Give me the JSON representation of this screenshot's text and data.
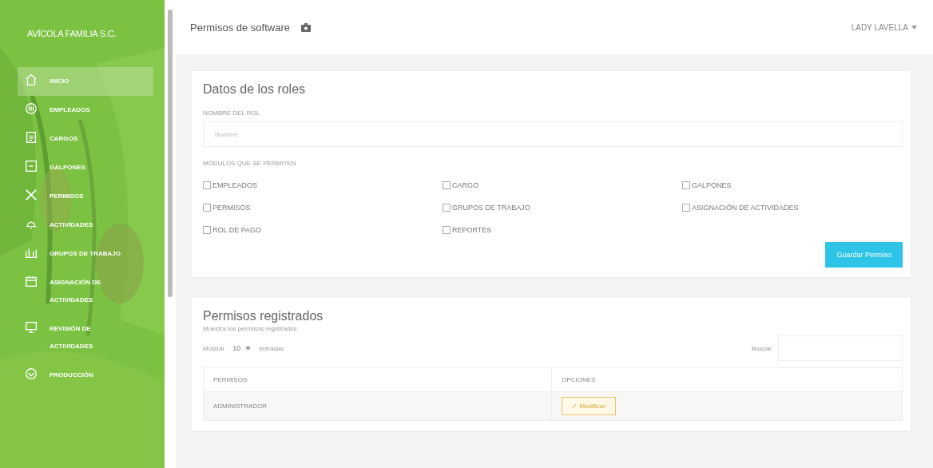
{
  "sidebar": {
    "brand": "AVÍCOLA FAMILIA S.C.",
    "items": [
      {
        "label": "INICIO",
        "selected": true
      },
      {
        "label": "EMPLEADOS",
        "selected": false
      },
      {
        "label": "CARGOS",
        "selected": false
      },
      {
        "label": "GALPONES",
        "selected": false
      },
      {
        "label": "PERMISOS",
        "selected": false
      },
      {
        "label": "ACTIVIDADES",
        "selected": false
      },
      {
        "label": "GRUPOS DE TRABAJO",
        "selected": false
      },
      {
        "label": "ASIGNACIÓN DE ACTIVIDADES",
        "selected": false
      },
      {
        "label": "REVISIÓN DE ACTIVIDADES",
        "selected": false
      },
      {
        "label": "PRODUCCIÓN",
        "selected": false
      }
    ]
  },
  "header": {
    "title": "Permisos de software",
    "user": "LADY LAVELLA"
  },
  "roles_card": {
    "title": "Datos de los roles",
    "name_label": "NOMBRE DEL ROL",
    "name_placeholder": "Nombre",
    "modules_label": "MÓDULOS QUE SE PERMITEN",
    "modules": [
      {
        "label": "EMPLEADOS",
        "checked": false
      },
      {
        "label": "CARGO",
        "checked": false
      },
      {
        "label": "GALPONES",
        "checked": false
      },
      {
        "label": "PERMISOS",
        "checked": false
      },
      {
        "label": "GRUPOS DE TRABAJO",
        "checked": false
      },
      {
        "label": "ASIGNACIÓN DE ACTIVIDADES",
        "checked": false
      },
      {
        "label": "ROL DE PAGO",
        "checked": false
      },
      {
        "label": "REPORTES",
        "checked": false
      }
    ],
    "save_button": "Guardar Permiso"
  },
  "registered_card": {
    "title": "Permisos registrados",
    "subtitle": "Muestra los permisos registrados",
    "show_label": "Mostrar",
    "page_size": "10",
    "entries_label": "entradas",
    "search_label": "Buscar:",
    "table": {
      "columns": [
        "PERMISOS",
        "OPCIONES"
      ],
      "rows": [
        {
          "name": "ADMINISTRADOR",
          "action": "✓ Modificar"
        }
      ]
    }
  }
}
